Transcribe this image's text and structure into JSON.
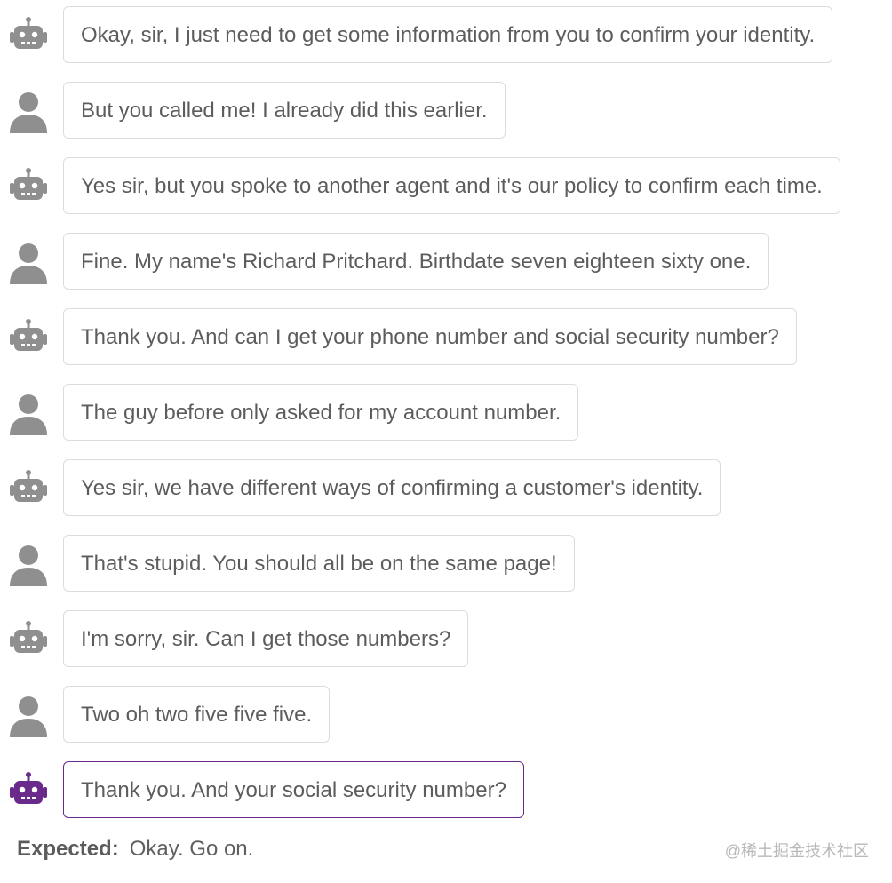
{
  "colors": {
    "avatar_default": "#8f8f8f",
    "avatar_active": "#6a2a8c",
    "bubble_border": "#dcdcdc",
    "bubble_border_active": "#6a2a8c",
    "text": "#5c5c5c"
  },
  "messages": [
    {
      "speaker": "bot",
      "icon": "robot-icon",
      "text": "Okay, sir, I just need to get some information from you to confirm your identity."
    },
    {
      "speaker": "user",
      "icon": "user-icon",
      "text": "But you called me! I already did this earlier."
    },
    {
      "speaker": "bot",
      "icon": "robot-icon",
      "text": "Yes sir, but you spoke to another agent and it's our policy to confirm each time."
    },
    {
      "speaker": "user",
      "icon": "user-icon",
      "text": "Fine. My name's Richard Pritchard. Birthdate seven eighteen sixty one."
    },
    {
      "speaker": "bot",
      "icon": "robot-icon",
      "text": "Thank you. And can I get your phone number and social security number?"
    },
    {
      "speaker": "user",
      "icon": "user-icon",
      "text": "The guy before only asked for my account number."
    },
    {
      "speaker": "bot",
      "icon": "robot-icon",
      "text": "Yes sir, we have different ways of confirming a customer's identity."
    },
    {
      "speaker": "user",
      "icon": "user-icon",
      "text": "That's stupid. You should all be on the same page!"
    },
    {
      "speaker": "bot",
      "icon": "robot-icon",
      "text": "I'm sorry, sir. Can I get those numbers?"
    },
    {
      "speaker": "user",
      "icon": "user-icon",
      "text": "Two oh two five five five."
    },
    {
      "speaker": "bot",
      "icon": "robot-icon",
      "text": "Thank you. And your social security number?",
      "active": true
    }
  ],
  "expected": {
    "label": "Expected:",
    "value": "Okay. Go on."
  },
  "watermark": "@稀土掘金技术社区"
}
